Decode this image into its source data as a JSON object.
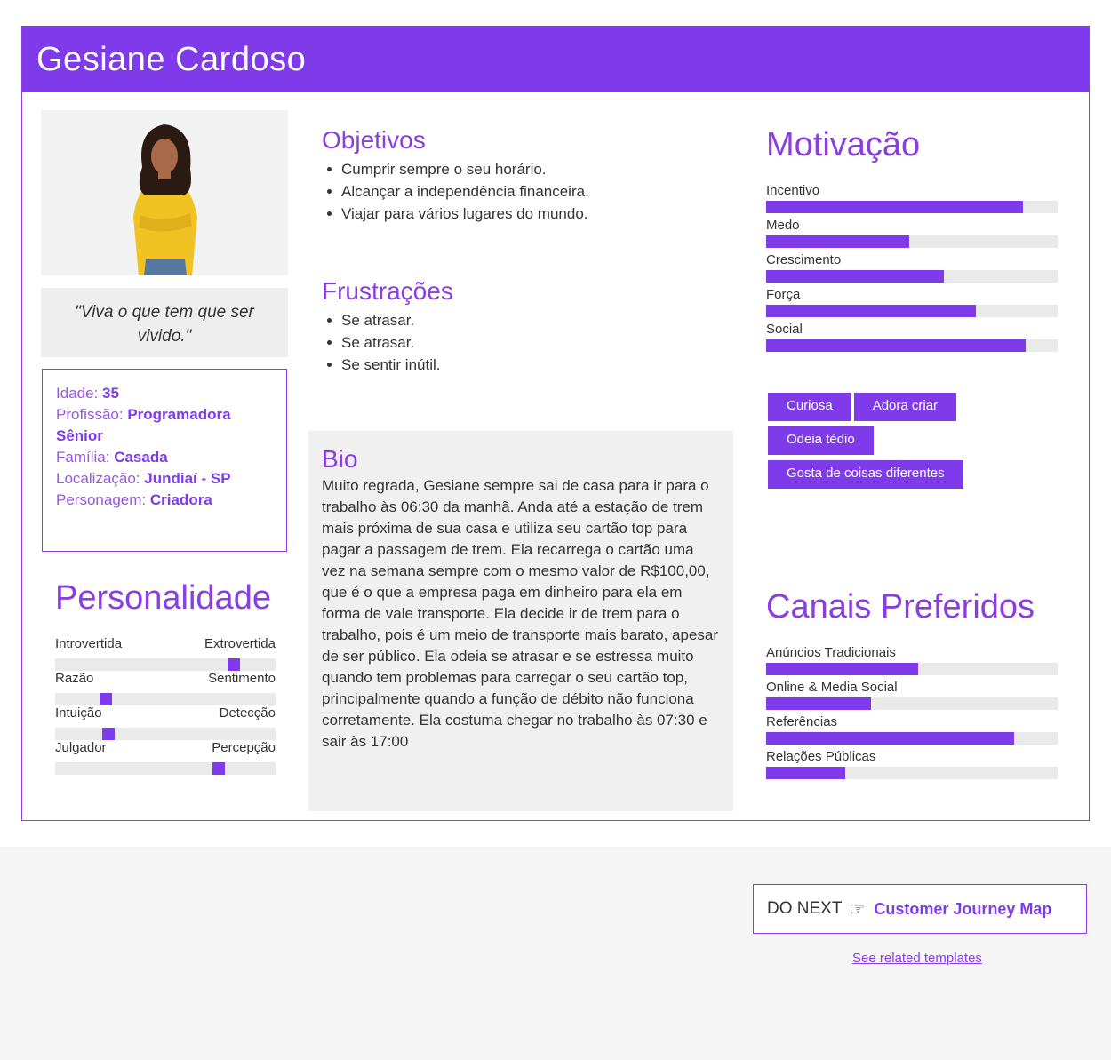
{
  "persona": {
    "name": "Gesiane Cardoso",
    "quote": "\"Viva o que tem que ser vivido.\""
  },
  "info": [
    {
      "label": "Idade:",
      "value": "35"
    },
    {
      "label": "Profissão:",
      "value": "Programadora Sênior"
    },
    {
      "label": "Família:",
      "value": "Casada"
    },
    {
      "label": "Localização:",
      "value": "Jundiaí - SP"
    },
    {
      "label": "Personagem:",
      "value": "Criadora"
    }
  ],
  "personality": {
    "title": "Personalidade",
    "traits": [
      {
        "left": "Introvertida",
        "right": "Extrovertida",
        "position": 0.81
      },
      {
        "left": "Razão",
        "right": "Sentimento",
        "position": 0.23
      },
      {
        "left": "Intuição",
        "right": "Detecção",
        "position": 0.24
      },
      {
        "left": "Julgador",
        "right": "Percepção",
        "position": 0.74
      }
    ]
  },
  "goals": {
    "title": "Objetivos",
    "items": [
      "Cumprir sempre o seu horário.",
      "Alcançar a independência financeira.",
      "Viajar para vários lugares do mundo."
    ]
  },
  "frustrations": {
    "title": "Frustrações",
    "items": [
      "Se atrasar.",
      "Se atrasar.",
      "Se sentir inútil."
    ]
  },
  "bio": {
    "title": "Bio",
    "text": "Muito regrada, Gesiane sempre sai de casa para ir para o trabalho às 06:30 da manhã. Anda até a estação de trem mais próxima de sua casa e utiliza seu cartão top para pagar a passagem de trem. Ela recarrega o cartão uma vez na semana sempre com o mesmo valor de R$100,00, que é o que a empresa paga em dinheiro para ela em forma de vale transporte. Ela decide ir de trem para o trabalho, pois é um meio de transporte mais barato, apesar de ser público. Ela odeia se atrasar e se estressa muito quando tem problemas para carregar o seu cartão top, principalmente quando a função de débito não funciona corretamente. Ela costuma chegar no trabalho às 07:30 e sair às 17:00"
  },
  "motivation": {
    "title": "Motivação",
    "items": [
      {
        "label": "Incentivo",
        "value": 0.88
      },
      {
        "label": "Medo",
        "value": 0.49
      },
      {
        "label": "Crescimento",
        "value": 0.61
      },
      {
        "label": "Força",
        "value": 0.72
      },
      {
        "label": "Social",
        "value": 0.89
      }
    ]
  },
  "tags": [
    "Curiosa",
    "Adora criar",
    "Odeia tédio",
    "Gosta de coisas diferentes"
  ],
  "channels": {
    "title": "Canais Preferidos",
    "items": [
      {
        "label": "Anúncios Tradicionais",
        "value": 0.52
      },
      {
        "label": "Online & Media Social",
        "value": 0.36
      },
      {
        "label": "Referências",
        "value": 0.85
      },
      {
        "label": "Relações Públicas",
        "value": 0.27
      }
    ]
  },
  "footer": {
    "do_next": "DO NEXT",
    "cta": "Customer Journey Map",
    "related": "See related templates"
  },
  "colors": {
    "accent": "#7f3aea",
    "track": "#eaeaea"
  }
}
